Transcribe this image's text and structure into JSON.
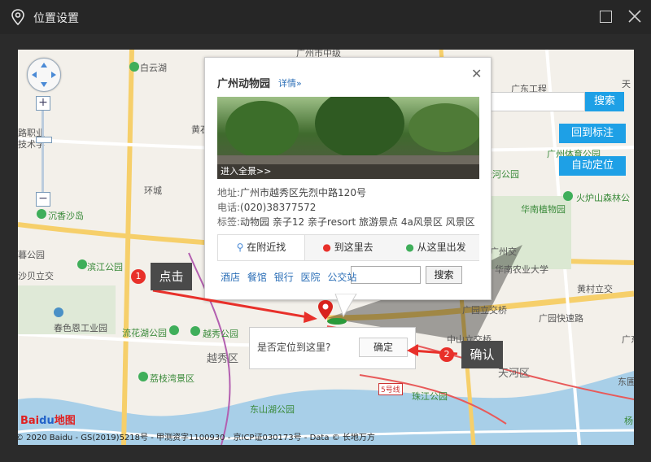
{
  "window": {
    "title": "位置设置"
  },
  "map": {
    "search_value": "广州动物园",
    "search_button": "搜索",
    "back_to_marker": "回到标注",
    "auto_locate": "自动定位",
    "labels": [
      "白云湖",
      "广州市中级",
      "黄石",
      "广东工程",
      "天",
      "路职业",
      "技术学",
      "环城",
      "广州体育公园",
      "沉香沙岛",
      "天河公园",
      "火炉山森林公",
      "华南植物园",
      "黄村立交",
      "广州交",
      "华南农业大学",
      "滨江公园",
      "广园立交桥",
      "广园快速路",
      "广东奥体",
      "春色恩工业园",
      "流花湖公园",
      "越秀公园",
      "越秀区",
      "中山立交桥",
      "荔枝湾景区",
      "东圃立交",
      "东山湖公园",
      "珠江公园",
      "杨",
      "沙贝立交",
      "暮公园",
      "5号线",
      "天河区"
    ],
    "brand": {
      "left": "Bai",
      "mid": "du",
      "right": "地图"
    },
    "copyright": "© 2020 Baidu - GS(2019)5218号 - 甲测资字1100930 - 京ICP证030173号 - Data © 长地万方"
  },
  "popup": {
    "title": "广州动物园",
    "detail_link": "详情»",
    "photo_caption": "进入全景>>",
    "address_label": "地址:",
    "address": "广州市越秀区先烈中路120号",
    "phone_label": "电话:",
    "phone": "(020)38377572",
    "tags_label": "标签:",
    "tags": "动物园 亲子12 亲子resort 旅游景点 4a风景区 风景区",
    "tabs": [
      "在附近找",
      "到这里去",
      "从这里出发"
    ],
    "nearby_links": [
      "酒店",
      "餐馆",
      "银行",
      "医院",
      "公交站"
    ],
    "nearby_search": "搜索"
  },
  "confirm": {
    "question": "是否定位到这里?",
    "ok": "确定"
  },
  "tips": [
    {
      "num": "1",
      "text": "点击"
    },
    {
      "num": "2",
      "text": "确认"
    }
  ],
  "colors": {
    "accent": "#1ea0e6",
    "badge": "#e8302a",
    "arrow": "#e8302a"
  }
}
